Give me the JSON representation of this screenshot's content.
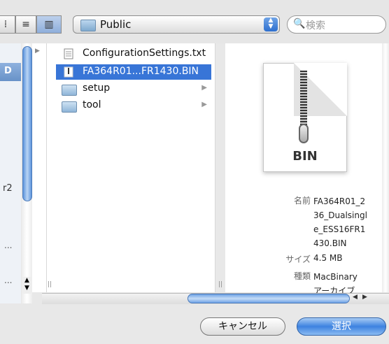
{
  "toolbar": {
    "view_modes": [
      "list",
      "columns"
    ],
    "location": "Public",
    "search_placeholder": "検索",
    "search_icon": "magnifier-icon"
  },
  "sidebar": {
    "labels": [
      "D",
      "r2",
      "...",
      "..."
    ]
  },
  "file_list": {
    "items": [
      {
        "name": "ConfigurationSettings.txt",
        "type": "text-file-icon",
        "has_children": false,
        "selected": false
      },
      {
        "name": "FA364R01...FR1430.BIN",
        "type": "binary-file-icon",
        "has_children": false,
        "selected": true
      },
      {
        "name": "setup",
        "type": "folder-icon",
        "has_children": true,
        "selected": false
      },
      {
        "name": "tool",
        "type": "folder-icon",
        "has_children": true,
        "selected": false
      }
    ]
  },
  "preview": {
    "icon_label": "BIN",
    "info": [
      {
        "key": "名前",
        "value_lines": [
          "FA364R01_2",
          "36_Dualsingl",
          "e_ESS16FR1",
          "430.BIN"
        ]
      },
      {
        "key": "サイズ",
        "value_lines": [
          "4.5 MB"
        ]
      },
      {
        "key": "種類",
        "value_lines": [
          "MacBinary",
          "アーカイブ"
        ]
      }
    ]
  },
  "buttons": {
    "cancel": "キャンセル",
    "choose": "選択"
  },
  "colors": {
    "selection": "#3875d7",
    "accent": "#3d82e0"
  }
}
